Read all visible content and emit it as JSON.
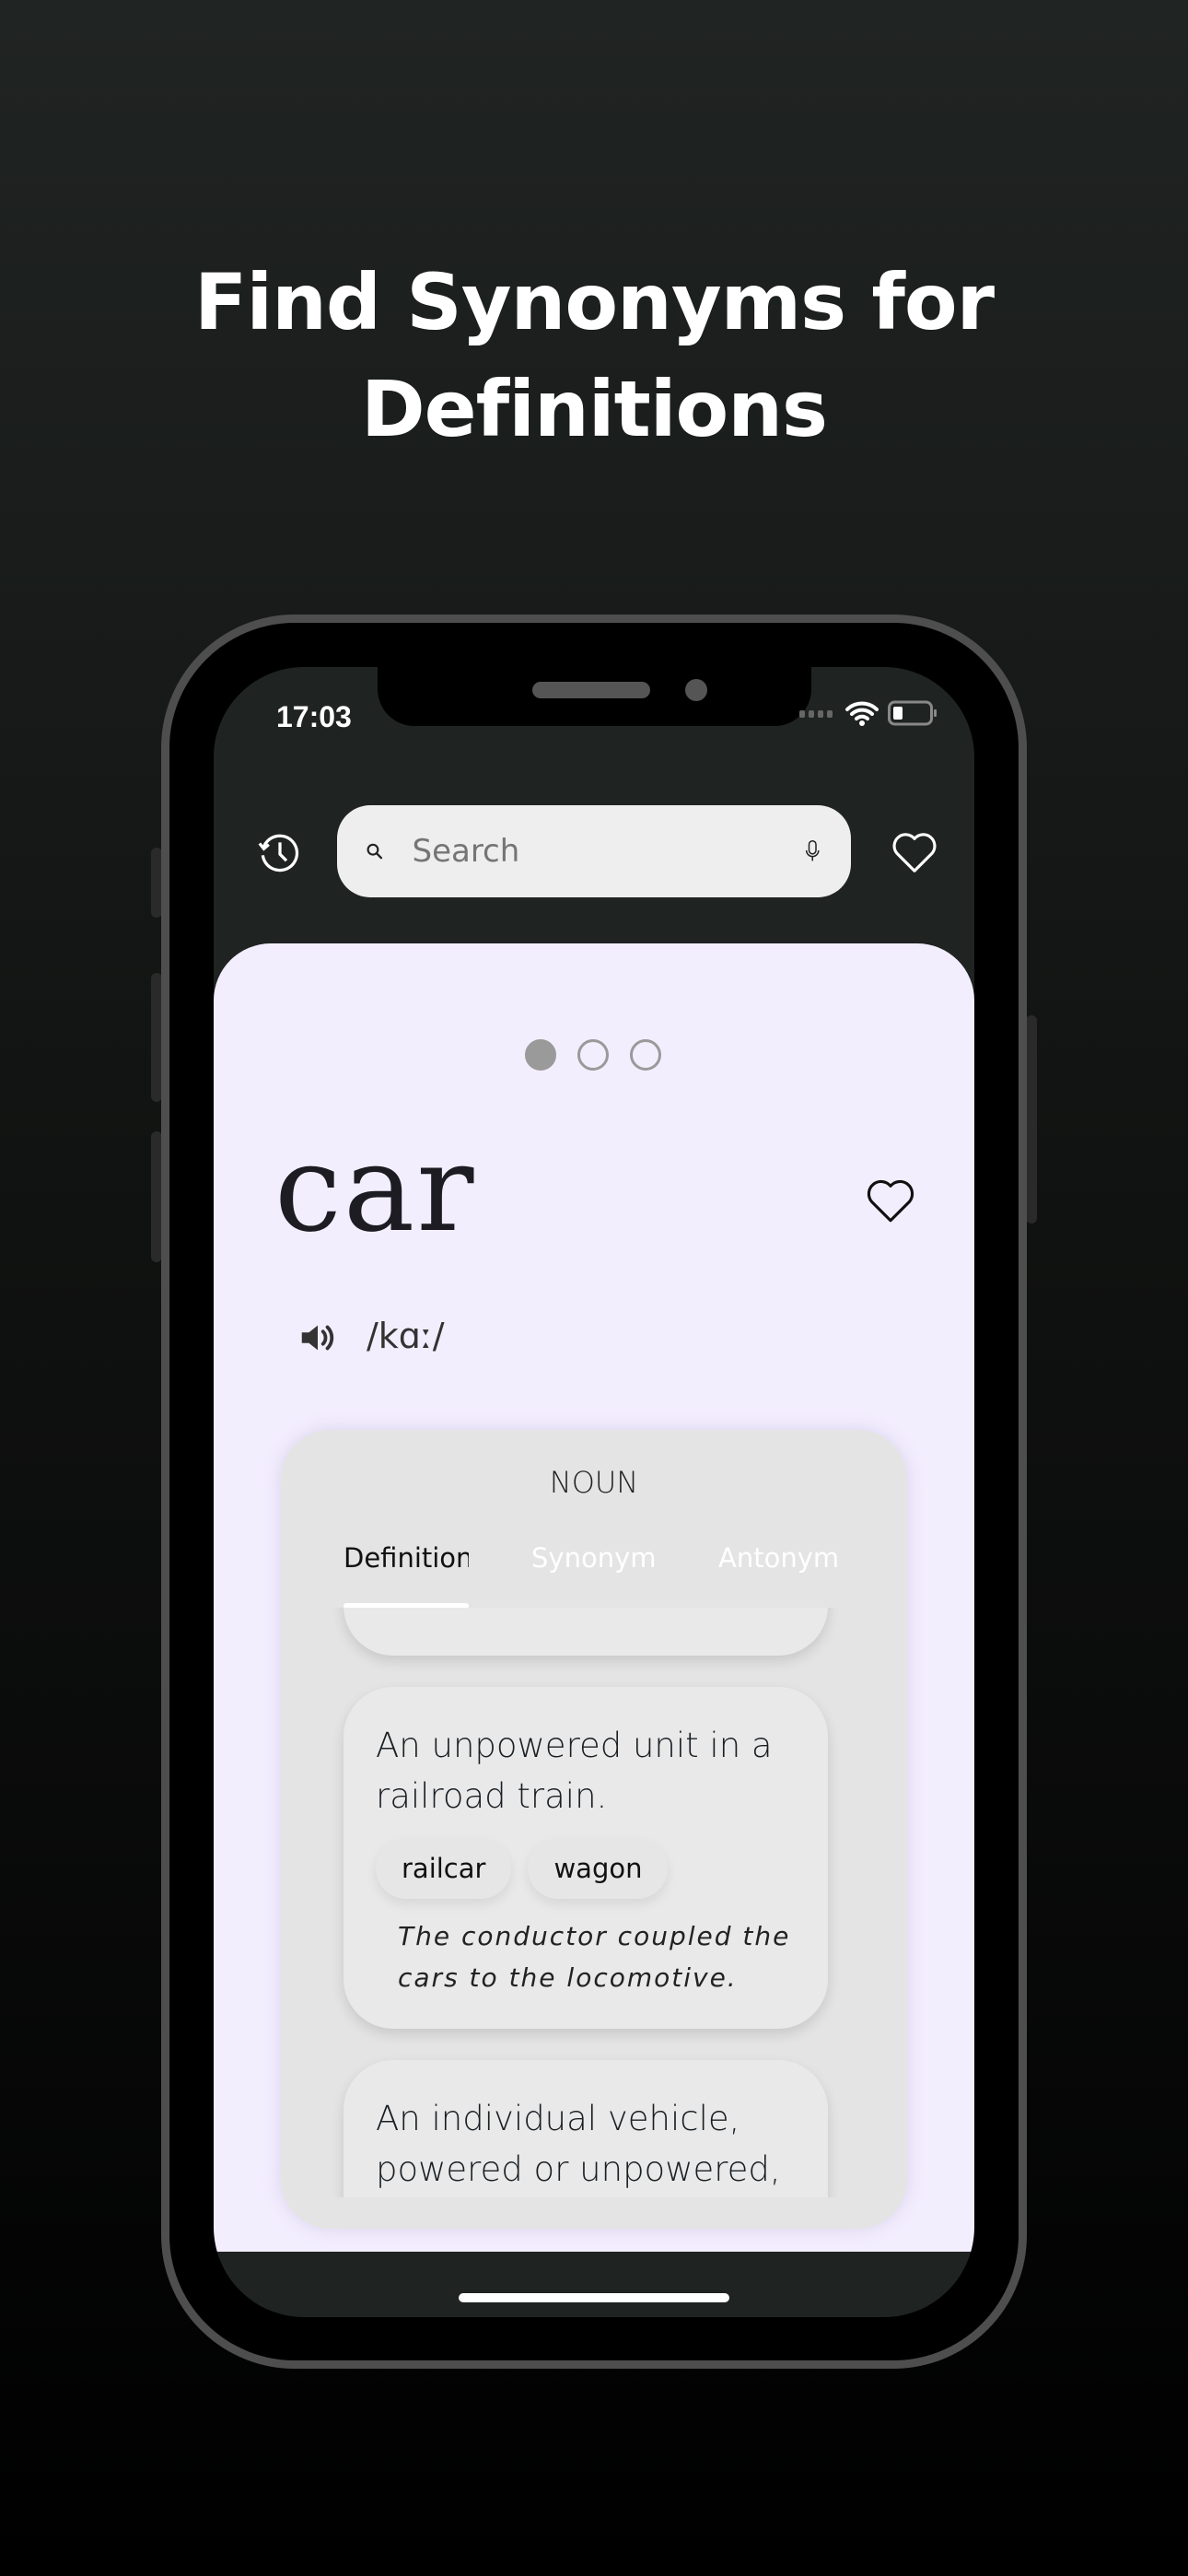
{
  "headline": {
    "line1": "Find Synonyms for",
    "line2": "Definitions"
  },
  "status_bar": {
    "time": "17:03"
  },
  "header": {
    "search_placeholder": "Search"
  },
  "pager": {
    "count": 3,
    "active": 0
  },
  "entry": {
    "word": "car",
    "pronunciation": "/kɑː/",
    "part_of_speech": "NOUN",
    "tabs": [
      {
        "label": "Definition",
        "active": true
      },
      {
        "label": "Synonym"
      },
      {
        "label": "Antonym"
      }
    ],
    "definitions": [
      {
        "text": "An unpowered unit in a railroad train.",
        "synonyms": [
          "railcar",
          "wagon"
        ],
        "example": "The conductor coupled the cars to the locomotive."
      },
      {
        "text": "An individual vehicle, powered or unpowered, in"
      }
    ]
  },
  "colors": {
    "panel": "#f3eefe",
    "screen": "#1f2321",
    "card": "#e4e4e4"
  }
}
